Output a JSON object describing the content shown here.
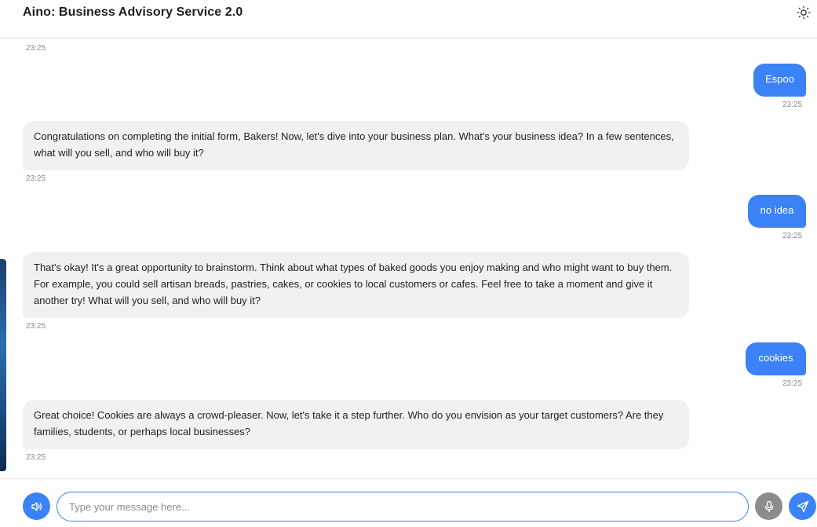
{
  "header": {
    "title": "Aino: Business Advisory Service 2.0",
    "theme_icon": "sun-icon"
  },
  "colors": {
    "accent": "#3b82f6",
    "bot_bubble": "#f1f1f1",
    "mic_button": "#8c8c8c"
  },
  "messages": [
    {
      "role": "timestamp",
      "time": "23:25"
    },
    {
      "role": "user",
      "text": "Espoo",
      "time": "23:25"
    },
    {
      "role": "assistant",
      "text": "Congratulations on completing the initial form, Bakers! Now, let's dive into your business plan. What's your business idea? In a few sentences, what will you sell, and who will buy it?",
      "time": "23:25"
    },
    {
      "role": "user",
      "text": "no idea",
      "time": "23:25"
    },
    {
      "role": "assistant",
      "text": "That's okay! It's a great opportunity to brainstorm. Think about what types of baked goods you enjoy making and who might want to buy them. For example, you could sell artisan breads, pastries, cakes, or cookies to local customers or cafes. Feel free to take a moment and give it another try! What will you sell, and who will buy it?",
      "time": "23:25"
    },
    {
      "role": "user",
      "text": "cookies",
      "time": "23:25"
    },
    {
      "role": "assistant",
      "text": "Great choice! Cookies are always a crowd-pleaser. Now, let's take it a step further. Who do you envision as your target customers? Are they families, students, or perhaps local businesses?",
      "time": "23:25"
    }
  ],
  "input": {
    "placeholder": "Type your message here...",
    "value": "",
    "speaker_icon": "speaker-icon",
    "mic_icon": "microphone-icon",
    "send_icon": "send-icon"
  }
}
